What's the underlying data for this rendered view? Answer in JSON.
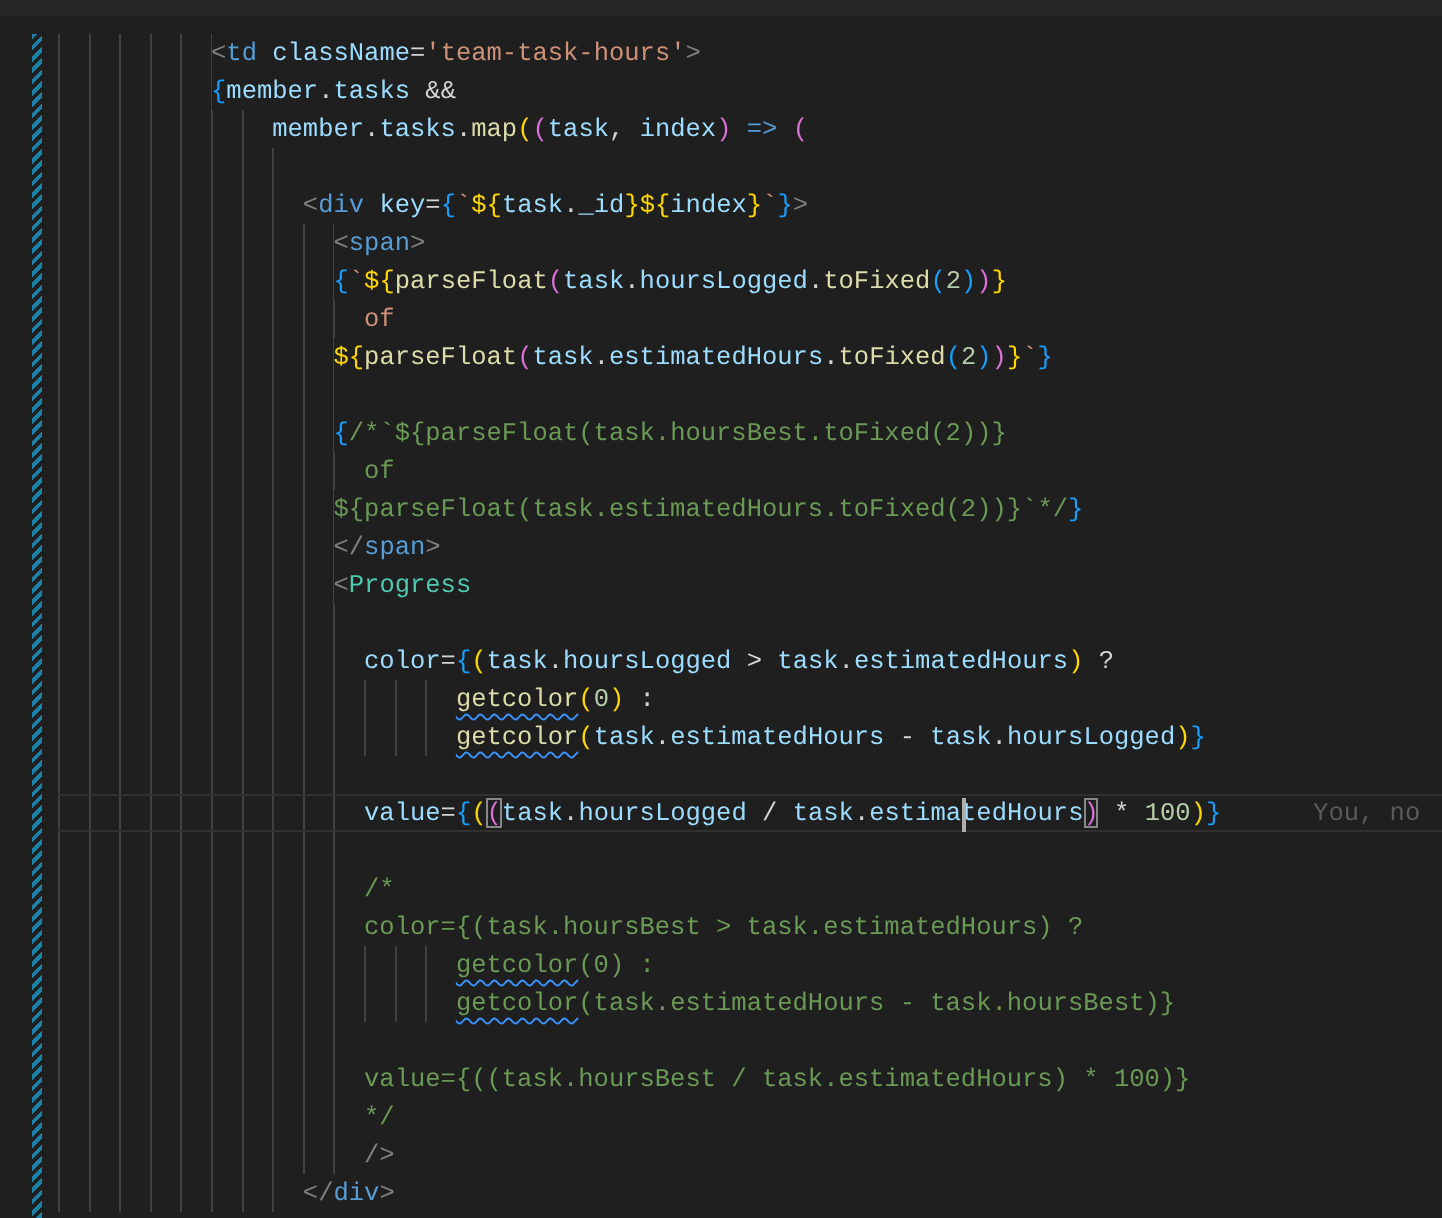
{
  "editor": {
    "lines": [
      {
        "kind": "code",
        "active": false,
        "tokens": [
          {
            "text": "          <",
            "kind": "punct"
          },
          {
            "text": "td",
            "kind": "tag"
          },
          {
            "text": " className",
            "kind": "attr"
          },
          {
            "text": "=",
            "kind": "plain"
          },
          {
            "text": "'team-task-hours'",
            "kind": "string"
          },
          {
            "text": ">",
            "kind": "punct"
          }
        ]
      },
      {
        "kind": "code",
        "active": false,
        "tokens": [
          {
            "text": "          {",
            "kind": "b3"
          },
          {
            "text": "member",
            "kind": "var"
          },
          {
            "text": ".",
            "kind": "plain"
          },
          {
            "text": "tasks",
            "kind": "var"
          },
          {
            "text": " &&",
            "kind": "plain"
          }
        ]
      },
      {
        "kind": "code",
        "active": false,
        "tokens": [
          {
            "text": "              member",
            "kind": "var"
          },
          {
            "text": ".",
            "kind": "plain"
          },
          {
            "text": "tasks",
            "kind": "var"
          },
          {
            "text": ".",
            "kind": "plain"
          },
          {
            "text": "map",
            "kind": "func"
          },
          {
            "text": "(",
            "kind": "b1"
          },
          {
            "text": "(",
            "kind": "b2"
          },
          {
            "text": "task",
            "kind": "var"
          },
          {
            "text": ", ",
            "kind": "plain"
          },
          {
            "text": "index",
            "kind": "var"
          },
          {
            "text": ")",
            "kind": "b2"
          },
          {
            "text": " =>",
            "kind": "keyword"
          },
          {
            "text": " (",
            "kind": "b2"
          }
        ]
      },
      {
        "kind": "blank",
        "active": false
      },
      {
        "kind": "code",
        "active": false,
        "tokens": [
          {
            "text": "                <",
            "kind": "punct"
          },
          {
            "text": "div",
            "kind": "tag"
          },
          {
            "text": " key",
            "kind": "attr"
          },
          {
            "text": "=",
            "kind": "plain"
          },
          {
            "text": "{",
            "kind": "b3"
          },
          {
            "text": "`",
            "kind": "string"
          },
          {
            "text": "${",
            "kind": "b1"
          },
          {
            "text": "task",
            "kind": "var"
          },
          {
            "text": ".",
            "kind": "plain"
          },
          {
            "text": "_id",
            "kind": "var"
          },
          {
            "text": "}",
            "kind": "b1"
          },
          {
            "text": "${",
            "kind": "b1"
          },
          {
            "text": "index",
            "kind": "var"
          },
          {
            "text": "}",
            "kind": "b1"
          },
          {
            "text": "`",
            "kind": "string"
          },
          {
            "text": "}",
            "kind": "b3"
          },
          {
            "text": ">",
            "kind": "punct"
          }
        ]
      },
      {
        "kind": "code",
        "active": false,
        "tokens": [
          {
            "text": "                  <",
            "kind": "punct"
          },
          {
            "text": "span",
            "kind": "tag"
          },
          {
            "text": ">",
            "kind": "punct"
          }
        ]
      },
      {
        "kind": "code",
        "active": false,
        "tokens": [
          {
            "text": "                  {",
            "kind": "b3"
          },
          {
            "text": "`",
            "kind": "string"
          },
          {
            "text": "${",
            "kind": "b1"
          },
          {
            "text": "parseFloat",
            "kind": "func"
          },
          {
            "text": "(",
            "kind": "b2"
          },
          {
            "text": "task",
            "kind": "var"
          },
          {
            "text": ".",
            "kind": "plain"
          },
          {
            "text": "hoursLogged",
            "kind": "var"
          },
          {
            "text": ".",
            "kind": "plain"
          },
          {
            "text": "toFixed",
            "kind": "func"
          },
          {
            "text": "(",
            "kind": "b3"
          },
          {
            "text": "2",
            "kind": "num"
          },
          {
            "text": ")",
            "kind": "b3"
          },
          {
            "text": ")",
            "kind": "b2"
          },
          {
            "text": "}",
            "kind": "b1"
          }
        ]
      },
      {
        "kind": "code",
        "active": false,
        "tokens": [
          {
            "text": "                    of",
            "kind": "string"
          }
        ]
      },
      {
        "kind": "code",
        "active": false,
        "tokens": [
          {
            "text": "                  ${",
            "kind": "b1"
          },
          {
            "text": "parseFloat",
            "kind": "func"
          },
          {
            "text": "(",
            "kind": "b2"
          },
          {
            "text": "task",
            "kind": "var"
          },
          {
            "text": ".",
            "kind": "plain"
          },
          {
            "text": "estimatedHours",
            "kind": "var"
          },
          {
            "text": ".",
            "kind": "plain"
          },
          {
            "text": "toFixed",
            "kind": "func"
          },
          {
            "text": "(",
            "kind": "b3"
          },
          {
            "text": "2",
            "kind": "num"
          },
          {
            "text": ")",
            "kind": "b3"
          },
          {
            "text": ")",
            "kind": "b2"
          },
          {
            "text": "}",
            "kind": "b1"
          },
          {
            "text": "`",
            "kind": "string"
          },
          {
            "text": "}",
            "kind": "b3"
          }
        ]
      },
      {
        "kind": "blank",
        "active": false
      },
      {
        "kind": "code",
        "active": false,
        "tokens": [
          {
            "text": "                  {",
            "kind": "b3"
          },
          {
            "text": "/*`${parseFloat(task.hoursBest.toFixed(2))}",
            "kind": "comment"
          }
        ]
      },
      {
        "kind": "code",
        "active": false,
        "tokens": [
          {
            "text": "                    of",
            "kind": "comment"
          }
        ]
      },
      {
        "kind": "code",
        "active": false,
        "tokens": [
          {
            "text": "                  ${parseFloat(task.estimatedHours.toFixed(2))}`*/",
            "kind": "comment"
          },
          {
            "text": "}",
            "kind": "b3"
          }
        ]
      },
      {
        "kind": "code",
        "active": false,
        "tokens": [
          {
            "text": "                  </",
            "kind": "punct"
          },
          {
            "text": "span",
            "kind": "tag"
          },
          {
            "text": ">",
            "kind": "punct"
          }
        ]
      },
      {
        "kind": "code",
        "active": false,
        "tokens": [
          {
            "text": "                  <",
            "kind": "punct"
          },
          {
            "text": "Progress",
            "kind": "component"
          }
        ]
      },
      {
        "kind": "blank",
        "active": false
      },
      {
        "kind": "code",
        "active": false,
        "tokens": [
          {
            "text": "                    color",
            "kind": "attr"
          },
          {
            "text": "=",
            "kind": "plain"
          },
          {
            "text": "{",
            "kind": "b3"
          },
          {
            "text": "(",
            "kind": "b1"
          },
          {
            "text": "task",
            "kind": "var"
          },
          {
            "text": ".",
            "kind": "plain"
          },
          {
            "text": "hoursLogged",
            "kind": "var"
          },
          {
            "text": " > ",
            "kind": "plain"
          },
          {
            "text": "task",
            "kind": "var"
          },
          {
            "text": ".",
            "kind": "plain"
          },
          {
            "text": "estimatedHours",
            "kind": "var"
          },
          {
            "text": ")",
            "kind": "b1"
          },
          {
            "text": " ?",
            "kind": "plain"
          }
        ]
      },
      {
        "kind": "code",
        "active": false,
        "tokens": [
          {
            "text": "                          getcolor",
            "kind": "func",
            "squiggle": true
          },
          {
            "text": "(",
            "kind": "b1"
          },
          {
            "text": "0",
            "kind": "num"
          },
          {
            "text": ")",
            "kind": "b1"
          },
          {
            "text": " :",
            "kind": "plain"
          }
        ]
      },
      {
        "kind": "code",
        "active": false,
        "tokens": [
          {
            "text": "                          getcolor",
            "kind": "func",
            "squiggle": true
          },
          {
            "text": "(",
            "kind": "b1"
          },
          {
            "text": "task",
            "kind": "var"
          },
          {
            "text": ".",
            "kind": "plain"
          },
          {
            "text": "estimatedHours",
            "kind": "var"
          },
          {
            "text": " - ",
            "kind": "plain"
          },
          {
            "text": "task",
            "kind": "var"
          },
          {
            "text": ".",
            "kind": "plain"
          },
          {
            "text": "hoursLogged",
            "kind": "var"
          },
          {
            "text": ")",
            "kind": "b1"
          },
          {
            "text": "}",
            "kind": "b3"
          }
        ]
      },
      {
        "kind": "blank",
        "active": false
      },
      {
        "kind": "code",
        "active": true,
        "blame": "You, no",
        "tokens": [
          {
            "text": "                    value",
            "kind": "attr"
          },
          {
            "text": "=",
            "kind": "plain"
          },
          {
            "text": "{",
            "kind": "b3"
          },
          {
            "text": "(",
            "kind": "b1"
          },
          {
            "text": "(",
            "kind": "b2",
            "match": true
          },
          {
            "text": "task",
            "kind": "var"
          },
          {
            "text": ".",
            "kind": "plain"
          },
          {
            "text": "hoursLogged",
            "kind": "var"
          },
          {
            "text": " / ",
            "kind": "plain"
          },
          {
            "text": "task",
            "kind": "var"
          },
          {
            "text": ".",
            "kind": "plain"
          },
          {
            "text": "estima",
            "kind": "var"
          },
          {
            "text": "tedHours",
            "kind": "var",
            "cursor": true
          },
          {
            "text": ")",
            "kind": "b2",
            "match": true
          },
          {
            "text": " * ",
            "kind": "plain"
          },
          {
            "text": "100",
            "kind": "num"
          },
          {
            "text": ")",
            "kind": "b1"
          },
          {
            "text": "}",
            "kind": "b3"
          }
        ]
      },
      {
        "kind": "blank",
        "active": false
      },
      {
        "kind": "code",
        "active": false,
        "tokens": [
          {
            "text": "                    /*",
            "kind": "comment"
          }
        ]
      },
      {
        "kind": "code",
        "active": false,
        "tokens": [
          {
            "text": "                    color={(task.hoursBest > task.estimatedHours) ?",
            "kind": "comment"
          }
        ]
      },
      {
        "kind": "code",
        "active": false,
        "tokens": [
          {
            "text": "                          getcolor",
            "kind": "comment",
            "squiggle": true
          },
          {
            "text": "(0) :",
            "kind": "comment"
          }
        ]
      },
      {
        "kind": "code",
        "active": false,
        "tokens": [
          {
            "text": "                          getcolor",
            "kind": "comment",
            "squiggle": true
          },
          {
            "text": "(task.estimatedHours - task.hoursBest)}",
            "kind": "comment"
          }
        ]
      },
      {
        "kind": "blank",
        "active": false
      },
      {
        "kind": "code",
        "active": false,
        "tokens": [
          {
            "text": "                    value={((task.hoursBest / task.estimatedHours) * 100)}",
            "kind": "comment"
          }
        ]
      },
      {
        "kind": "code",
        "active": false,
        "tokens": [
          {
            "text": "                    */",
            "kind": "comment"
          }
        ]
      },
      {
        "kind": "code",
        "active": false,
        "tokens": [
          {
            "text": "                    />",
            "kind": "punct"
          }
        ]
      },
      {
        "kind": "code",
        "active": false,
        "tokens": [
          {
            "text": "                </",
            "kind": "punct"
          },
          {
            "text": "div",
            "kind": "tag"
          },
          {
            "text": ">",
            "kind": "punct"
          }
        ]
      }
    ]
  }
}
